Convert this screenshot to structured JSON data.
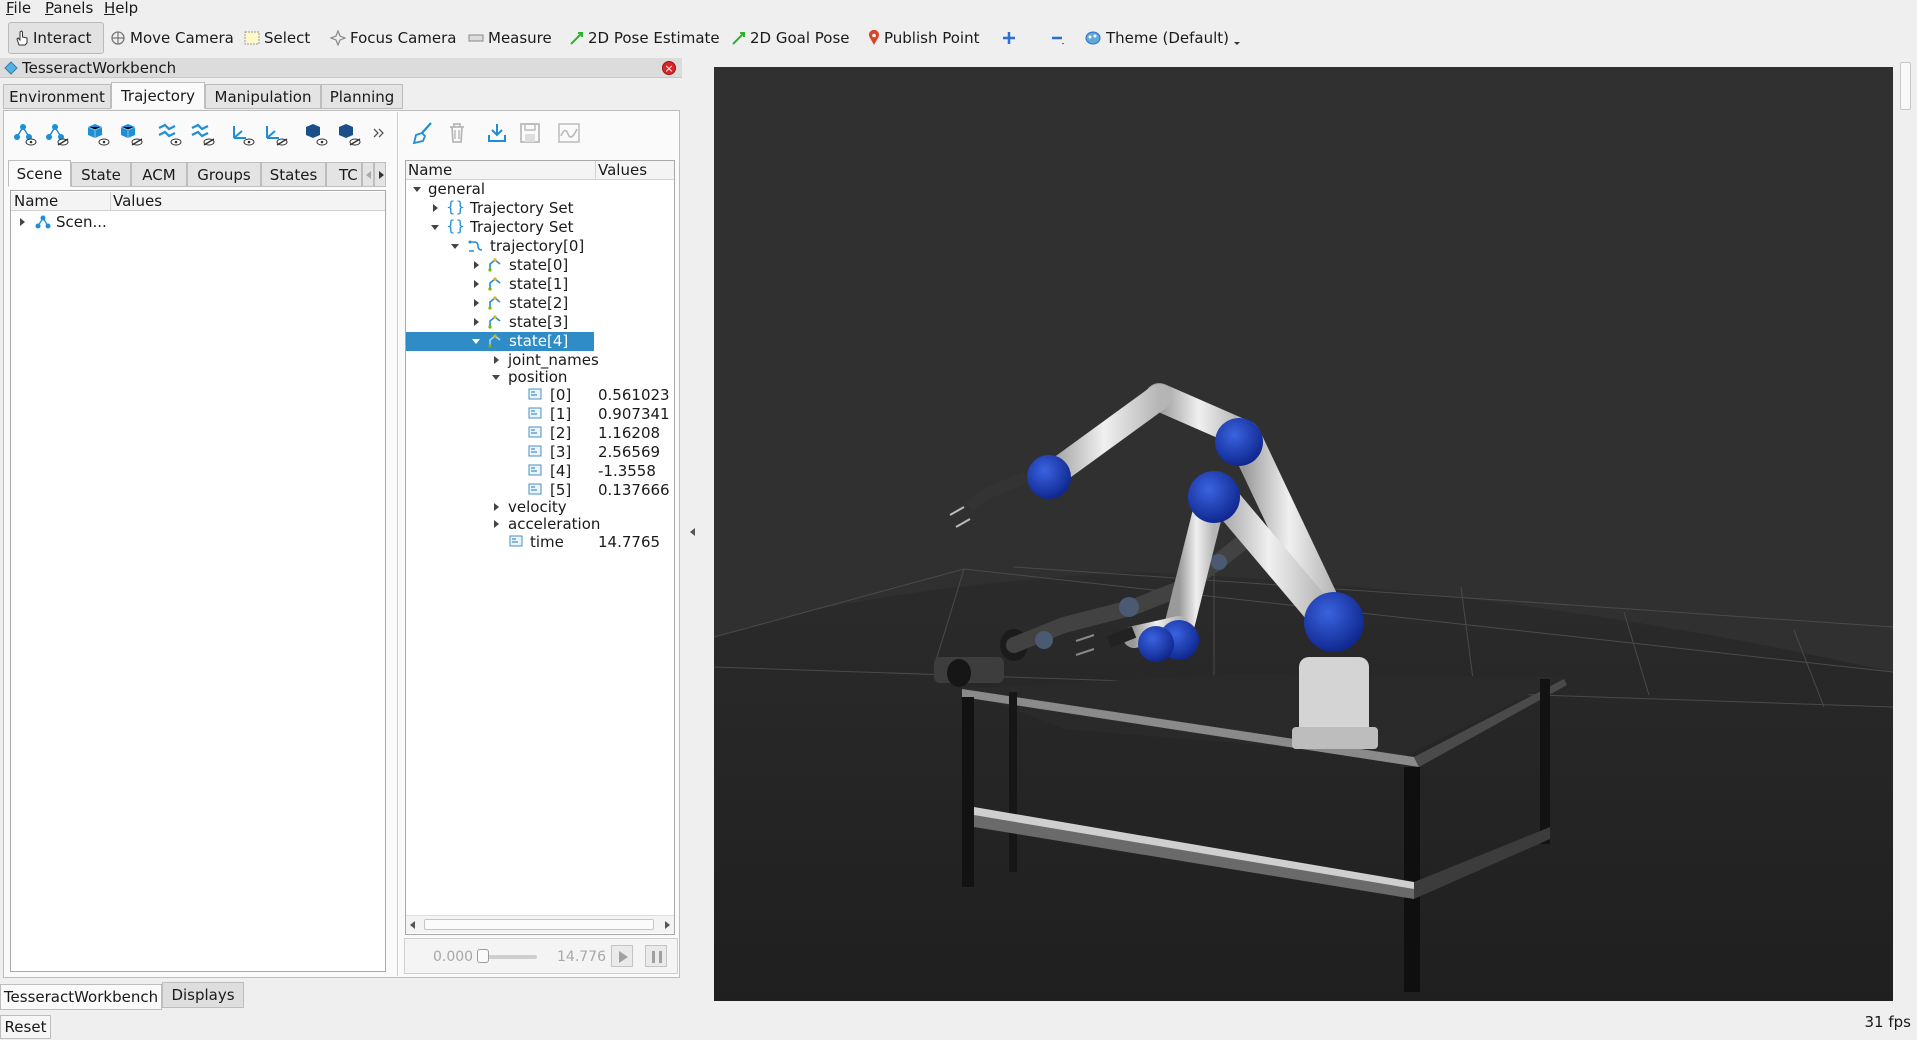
{
  "menu": {
    "file": "File",
    "panels": "Panels",
    "help": "Help"
  },
  "toolbar": {
    "interact": "Interact",
    "move_camera": "Move Camera",
    "select": "Select",
    "focus_camera": "Focus Camera",
    "measure": "Measure",
    "pose_estimate": "2D Pose Estimate",
    "goal_pose": "2D Goal Pose",
    "publish_point": "Publish Point",
    "theme": "Theme (Default)"
  },
  "panel": {
    "title": "TesseractWorkbench",
    "close": "×"
  },
  "main_tabs": [
    "Environment",
    "Trajectory",
    "Manipulation",
    "Planning"
  ],
  "scene_tabs": [
    "Scene",
    "State",
    "ACM",
    "Groups",
    "States",
    "TC"
  ],
  "scene_tree": {
    "header_name": "Name",
    "header_values": "Values",
    "root": "Scen..."
  },
  "traj_tree": {
    "header_name": "Name",
    "header_values": "Values",
    "general": "general",
    "set1": "Trajectory Set",
    "set2": "Trajectory Set",
    "trajectory": "trajectory[0]",
    "states": [
      "state[0]",
      "state[1]",
      "state[2]",
      "state[3]",
      "state[4]"
    ],
    "joint_names": "joint_names",
    "position": "position",
    "positions": [
      {
        "idx": "[0]",
        "val": "0.561023"
      },
      {
        "idx": "[1]",
        "val": "0.907341"
      },
      {
        "idx": "[2]",
        "val": "1.16208"
      },
      {
        "idx": "[3]",
        "val": "2.56569"
      },
      {
        "idx": "[4]",
        "val": "-1.3558"
      },
      {
        "idx": "[5]",
        "val": "0.137666"
      }
    ],
    "velocity": "velocity",
    "acceleration": "acceleration",
    "time_label": "time",
    "time_value": "14.7765"
  },
  "player": {
    "start": "0.000",
    "end": "14.776",
    "position": 0.0
  },
  "bottom_tabs": [
    "TesseractWorkbench",
    "Displays"
  ],
  "status": {
    "reset": "Reset",
    "fps": "31 fps"
  },
  "colors": {
    "selection": "#308cc6",
    "accent": "#1e8fd6",
    "joint_blue": "#1a3bb0",
    "viewport_bg": "#303030"
  }
}
